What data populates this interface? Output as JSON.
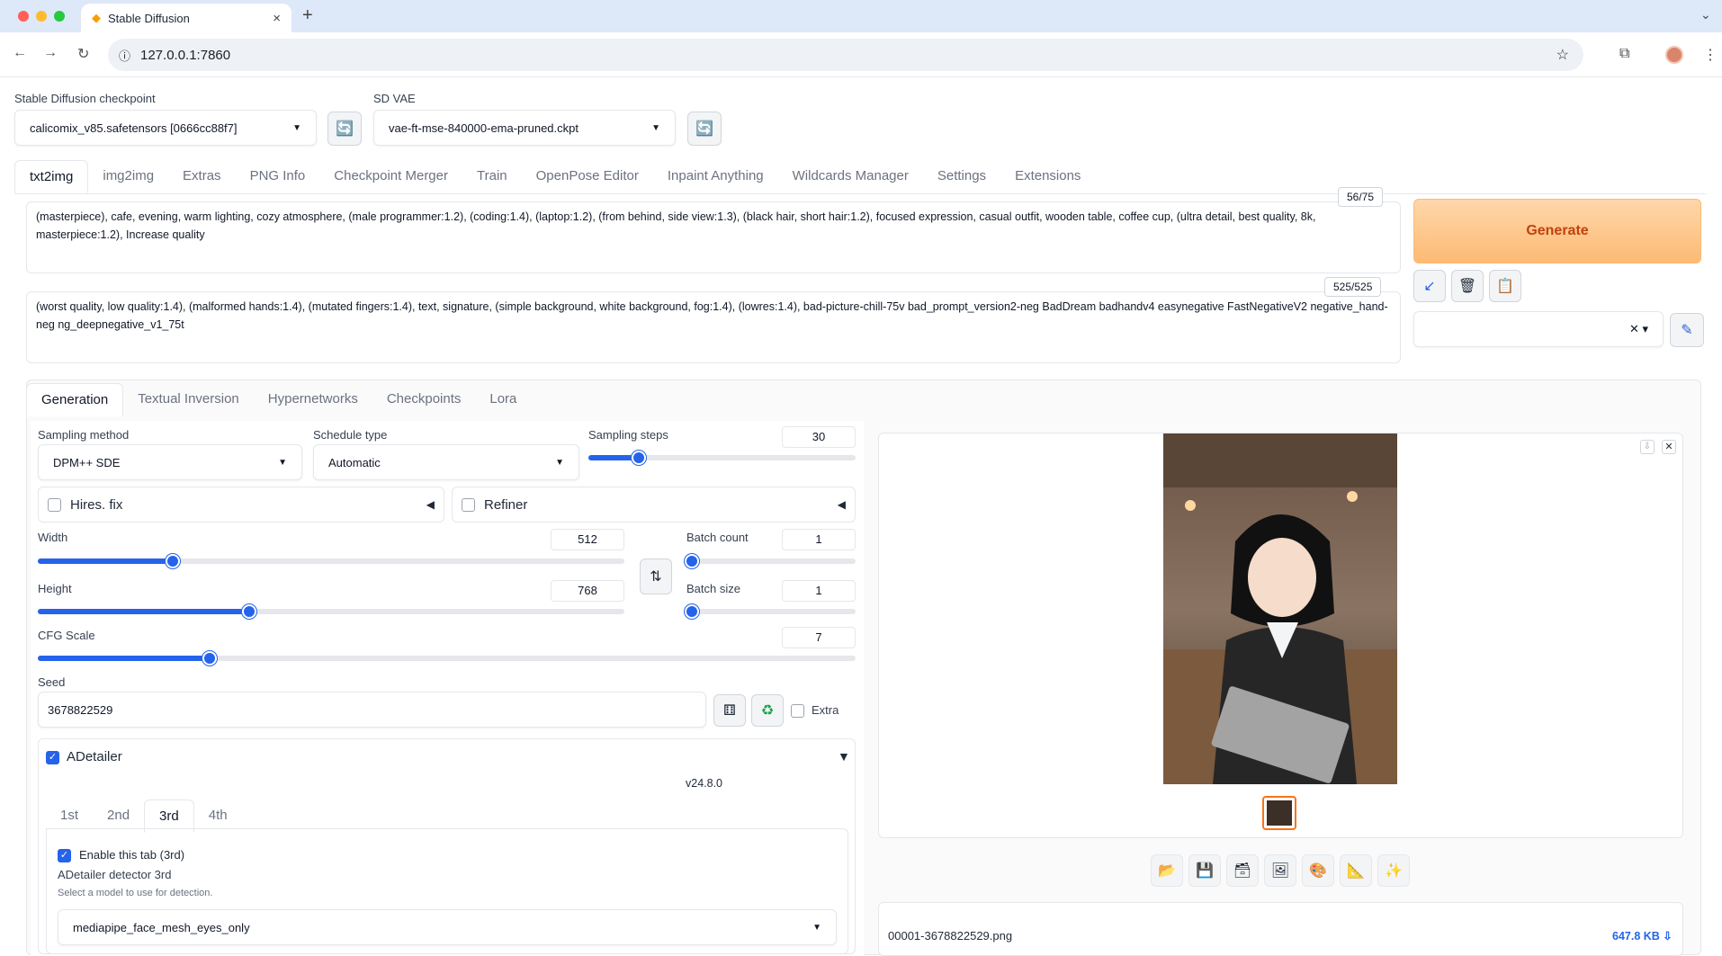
{
  "browser": {
    "tab_title": "Stable Diffusion",
    "url": "127.0.0.1:7860"
  },
  "top": {
    "checkpoint_label": "Stable Diffusion checkpoint",
    "checkpoint_value": "calicomix_v85.safetensors [0666cc88f7]",
    "vae_label": "SD VAE",
    "vae_value": "vae-ft-mse-840000-ema-pruned.ckpt"
  },
  "main_tabs": [
    "txt2img",
    "img2img",
    "Extras",
    "PNG Info",
    "Checkpoint Merger",
    "Train",
    "OpenPose Editor",
    "Inpaint Anything",
    "Wildcards Manager",
    "Settings",
    "Extensions"
  ],
  "prompt": {
    "positive": "(masterpiece), cafe, evening, warm lighting, cozy atmosphere, (male programmer:1.2), (coding:1.4), (laptop:1.2), (from behind, side view:1.3), (black hair, short hair:1.2), focused expression, casual outfit, wooden table, coffee cup, (ultra detail, best quality, 8k, masterpiece:1.2), Increase quality",
    "positive_count": "56/75",
    "negative": "(worst quality, low quality:1.4), (malformed hands:1.4), (mutated fingers:1.4), text, signature, (simple background, white background, fog:1.4), (lowres:1.4), bad-picture-chill-75v bad_prompt_version2-neg BadDream badhandv4 easynegative FastNegativeV2 negative_hand-neg ng_deepnegative_v1_75t",
    "negative_count": "525/525"
  },
  "generate_label": "Generate",
  "sub_tabs": [
    "Generation",
    "Textual Inversion",
    "Hypernetworks",
    "Checkpoints",
    "Lora"
  ],
  "generation": {
    "sampling_method_label": "Sampling method",
    "sampling_method": "DPM++ SDE",
    "schedule_type_label": "Schedule type",
    "schedule_type": "Automatic",
    "sampling_steps_label": "Sampling steps",
    "sampling_steps": "30",
    "sampling_steps_frac": 0.19,
    "hires_label": "Hires. fix",
    "refiner_label": "Refiner",
    "width_label": "Width",
    "width": "512",
    "width_frac": 0.23,
    "height_label": "Height",
    "height": "768",
    "height_frac": 0.36,
    "batch_count_label": "Batch count",
    "batch_count": "1",
    "batch_size_label": "Batch size",
    "batch_size": "1",
    "cfg_label": "CFG Scale",
    "cfg": "7",
    "cfg_frac": 0.21,
    "seed_label": "Seed",
    "seed": "3678822529",
    "extra_label": "Extra"
  },
  "adetailer": {
    "label": "ADetailer",
    "version": "v24.8.0",
    "tabs": [
      "1st",
      "2nd",
      "3rd",
      "4th"
    ],
    "enable_label": "Enable this tab (3rd)",
    "detector_label": "ADetailer detector 3rd",
    "detector_hint": "Select a model to use for detection.",
    "detector_value": "mediapipe_face_mesh_eyes_only"
  },
  "output": {
    "filename": "00001-3678822529.png",
    "filesize": "647.8 KB"
  }
}
